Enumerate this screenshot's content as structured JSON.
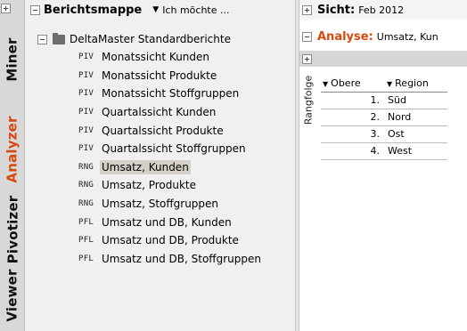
{
  "modes": {
    "items": [
      {
        "label": "Miner",
        "active": false
      },
      {
        "label": "Analyzer",
        "active": true
      },
      {
        "label": "Pivotizer",
        "active": false
      },
      {
        "label": "Viewer",
        "active": false
      }
    ]
  },
  "tree": {
    "title": "Berichtsmappe",
    "dropdown_label": "Ich möchte ...",
    "folder_label": "DeltaMaster Standardberichte",
    "items": [
      {
        "type": "PIV",
        "label": "Monatssicht Kunden"
      },
      {
        "type": "PIV",
        "label": "Monatssicht Produkte"
      },
      {
        "type": "PIV",
        "label": "Monatssicht Stoffgruppen"
      },
      {
        "type": "PIV",
        "label": "Quartalssicht Kunden"
      },
      {
        "type": "PIV",
        "label": "Quartalssicht Produkte"
      },
      {
        "type": "PIV",
        "label": "Quartalssicht Stoffgruppen"
      },
      {
        "type": "RNG",
        "label": "Umsatz, Kunden"
      },
      {
        "type": "RNG",
        "label": "Umsatz, Produkte"
      },
      {
        "type": "RNG",
        "label": "Umsatz, Stoffgruppen"
      },
      {
        "type": "PFL",
        "label": "Umsatz und DB, Kunden"
      },
      {
        "type": "PFL",
        "label": "Umsatz und DB, Produkte"
      },
      {
        "type": "PFL",
        "label": "Umsatz und DB, Stoffgruppen"
      }
    ],
    "selected_label": "Umsatz, Kunden"
  },
  "view": {
    "sicht_title": "Sicht:",
    "sicht_value": "Feb 2012",
    "analyse_title": "Analyse:",
    "analyse_value": "Umsatz, Kun",
    "side_label": "Rangfolge",
    "columns": [
      "Obere",
      "Region"
    ],
    "rows": [
      {
        "rank": "1.",
        "region": "Süd"
      },
      {
        "rank": "2.",
        "region": "Nord"
      },
      {
        "rank": "3.",
        "region": "Ost"
      },
      {
        "rank": "4.",
        "region": "West"
      }
    ]
  },
  "colors": {
    "accent": "#d9480f",
    "selection": "#d4d0c8"
  }
}
